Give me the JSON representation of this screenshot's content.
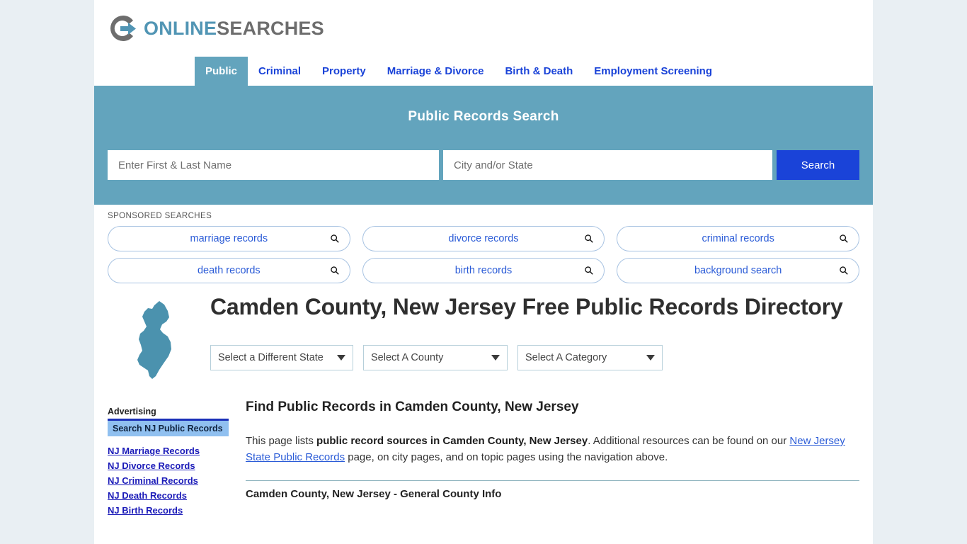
{
  "brand": {
    "name_part1": "ONLINE",
    "name_part2": "SEARCHES",
    "logo_icon": "circle-arrow-logo-icon",
    "accent_teal": "#63a4bd",
    "accent_blue": "#1a43d8",
    "logo_gray": "#6d6d6d"
  },
  "nav": {
    "items": [
      {
        "label": "Public",
        "active": true
      },
      {
        "label": "Criminal",
        "active": false
      },
      {
        "label": "Property",
        "active": false
      },
      {
        "label": "Marriage & Divorce",
        "active": false
      },
      {
        "label": "Birth & Death",
        "active": false
      },
      {
        "label": "Employment Screening",
        "active": false
      }
    ]
  },
  "banner": {
    "title": "Public Records Search",
    "name_value": "",
    "name_placeholder": "Enter First & Last Name",
    "city_value": "",
    "city_placeholder": "City and/or State",
    "search_button": "Search"
  },
  "sponsored": {
    "label": "SPONSORED SEARCHES",
    "icon": "magnifier-icon",
    "items": [
      {
        "label": "marriage records"
      },
      {
        "label": "divorce records"
      },
      {
        "label": "criminal records"
      },
      {
        "label": "death records"
      },
      {
        "label": "birth records"
      },
      {
        "label": "background search"
      }
    ]
  },
  "page": {
    "state_map_icon": "new-jersey-state-map-icon",
    "state_map_color": "#4b92ae",
    "title": "Camden County, New Jersey Free Public Records Directory"
  },
  "selects": {
    "state": {
      "label": "Select a Different State"
    },
    "county": {
      "label": "Select A County"
    },
    "category": {
      "label": "Select A Category"
    }
  },
  "sidebar": {
    "advertising_label": "Advertising",
    "promo_label": "Search NJ Public Records",
    "links": [
      {
        "label": "NJ Marriage Records"
      },
      {
        "label": "NJ Divorce Records"
      },
      {
        "label": "NJ Criminal Records"
      },
      {
        "label": "NJ Death Records"
      },
      {
        "label": "NJ Birth Records"
      }
    ]
  },
  "main": {
    "section_title": "Find Public Records in Camden County, New Jersey",
    "intro": {
      "part1": "This page lists ",
      "bold1": "public record sources in Camden County, New Jersey",
      "part2": ". Additional resources can be found on our ",
      "link1": "New Jersey State Public Records",
      "part3": " page, on city pages, and on topic pages using the navigation above."
    },
    "result_heading": "Camden County, New Jersey - General County Info"
  }
}
